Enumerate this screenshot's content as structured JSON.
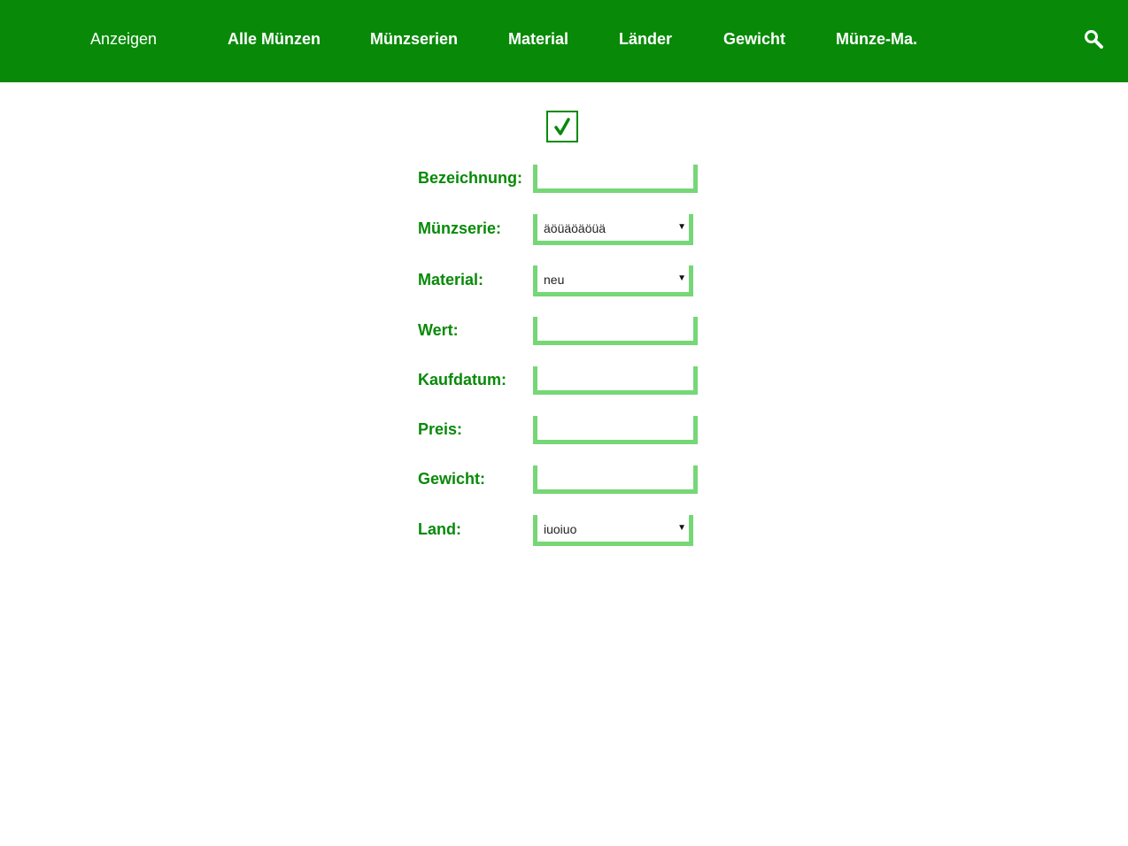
{
  "nav": {
    "items": [
      {
        "label": "Anzeigen"
      },
      {
        "label": "Alle Münzen"
      },
      {
        "label": "Münzserien"
      },
      {
        "label": "Material"
      },
      {
        "label": "Länder"
      },
      {
        "label": "Gewicht"
      },
      {
        "label": "Münze-Ma."
      }
    ],
    "search_icon": "search-icon"
  },
  "form": {
    "save_icon": "checkmark-icon",
    "fields": [
      {
        "label": "Bezeichnung:",
        "type": "text",
        "value": ""
      },
      {
        "label": "Münzserie:",
        "type": "select",
        "value": "äöüäöäöüä"
      },
      {
        "label": "Material:",
        "type": "select",
        "value": "neu"
      },
      {
        "label": "Wert:",
        "type": "text",
        "value": ""
      },
      {
        "label": "Kaufdatum:",
        "type": "text",
        "value": ""
      },
      {
        "label": "Preis:",
        "type": "text",
        "value": ""
      },
      {
        "label": "Gewicht:",
        "type": "text",
        "value": ""
      },
      {
        "label": "Land:",
        "type": "select",
        "value": "iuoiuo"
      }
    ]
  },
  "colors": {
    "primary": "#088a08",
    "input_border": "#76d776",
    "background": "#ffffff",
    "nav_text": "#ffffff"
  }
}
